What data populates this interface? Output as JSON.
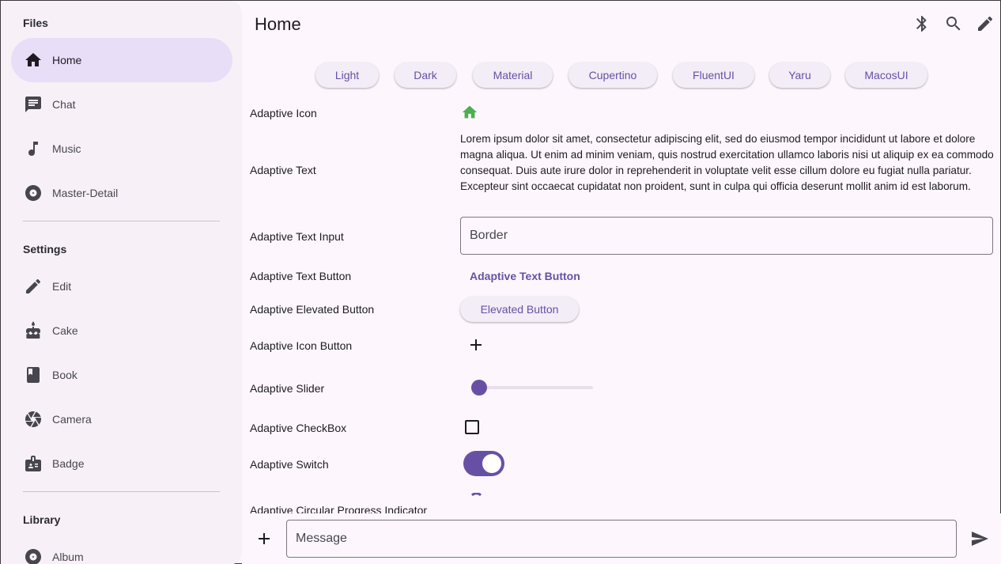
{
  "sidebar": {
    "sections": [
      {
        "title": "Files"
      },
      {
        "title": "Settings"
      },
      {
        "title": "Library"
      }
    ],
    "items": [
      {
        "label": "Home",
        "icon": "home-icon",
        "active": true
      },
      {
        "label": "Chat",
        "icon": "chat-icon"
      },
      {
        "label": "Music",
        "icon": "music-note-icon"
      },
      {
        "label": "Master-Detail",
        "icon": "disc-icon"
      },
      {
        "label": "Edit",
        "icon": "pencil-icon"
      },
      {
        "label": "Cake",
        "icon": "cake-icon"
      },
      {
        "label": "Book",
        "icon": "book-icon"
      },
      {
        "label": "Camera",
        "icon": "camera-aperture-icon"
      },
      {
        "label": "Badge",
        "icon": "badge-icon"
      },
      {
        "label": "Album",
        "icon": "album-icon"
      }
    ]
  },
  "header": {
    "title": "Home",
    "actions": [
      "bluetooth-icon",
      "search-icon",
      "edit-icon"
    ]
  },
  "themes": [
    "Light",
    "Dark",
    "Material",
    "Cupertino",
    "FluentUI",
    "Yaru",
    "MacosUI"
  ],
  "rows": {
    "icon_label": "Adaptive Icon",
    "text_label": "Adaptive Text",
    "text_body": "Lorem ipsum dolor sit amet, consectetur adipiscing elit, sed do eiusmod tempor incididunt ut labore et dolore magna aliqua. Ut enim ad minim veniam, quis nostrud exercitation ullamco laboris nisi ut aliquip ex ea commodo consequat. Duis aute irure dolor in reprehenderit in voluptate velit esse cillum dolore eu fugiat nulla pariatur. Excepteur sint occaecat cupidatat non proident, sunt in culpa qui officia deserunt mollit anim id est laborum.",
    "input_label": "Adaptive Text Input",
    "input_value": "Border",
    "text_button_label": "Adaptive Text Button",
    "text_button_text": "Adaptive Text Button",
    "elevated_label": "Adaptive Elevated Button",
    "elevated_text": "Elevated Button",
    "icon_button_label": "Adaptive Icon Button",
    "slider_label": "Adaptive Slider",
    "slider_value": 0,
    "checkbox_label": "Adaptive CheckBox",
    "checkbox_checked": false,
    "switch_label": "Adaptive Switch",
    "switch_on": true,
    "progress_label": "Adaptive Circular Progress Indicator"
  },
  "composer": {
    "placeholder": "Message"
  },
  "colors": {
    "accent": "#6750a4",
    "adaptive_icon": "#4caf50",
    "selected_nav": "#e8def8"
  }
}
